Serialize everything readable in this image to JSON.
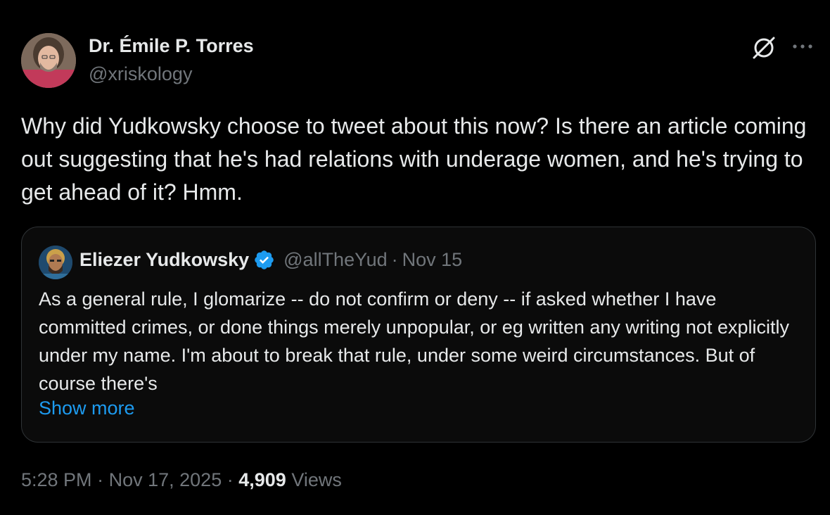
{
  "author": {
    "name": "Dr. Émile P. Torres",
    "handle": "@xriskology"
  },
  "tweet": {
    "text": "Why did Yudkowsky choose to tweet about this now? Is there an article coming out suggesting that he's had relations with underage women, and he's trying to get ahead of it? Hmm."
  },
  "quote": {
    "name": "Eliezer Yudkowsky",
    "handle": "@allTheYud",
    "separator": "·",
    "date": "Nov 15",
    "text": "As a general rule, I glomarize -- do not confirm or deny -- if asked whether I have committed crimes, or done things merely unpopular, or eg written any writing not explicitly under my name.  I'm about to break that rule, under some weird circumstances.  But of course there's",
    "show_more": "Show more"
  },
  "meta": {
    "time": "5:28 PM",
    "separator": "·",
    "date": "Nov 17, 2025",
    "views_count": "4,909",
    "views_label": "Views"
  },
  "colors": {
    "background": "#000000",
    "text_primary": "#e7e9ea",
    "text_secondary": "#71767b",
    "link": "#1d9bf0",
    "verified": "#1d9bf0",
    "border": "#2f3336"
  },
  "icons": {
    "grok": "grok-icon",
    "more": "more-icon",
    "verified": "verified-badge-icon"
  }
}
